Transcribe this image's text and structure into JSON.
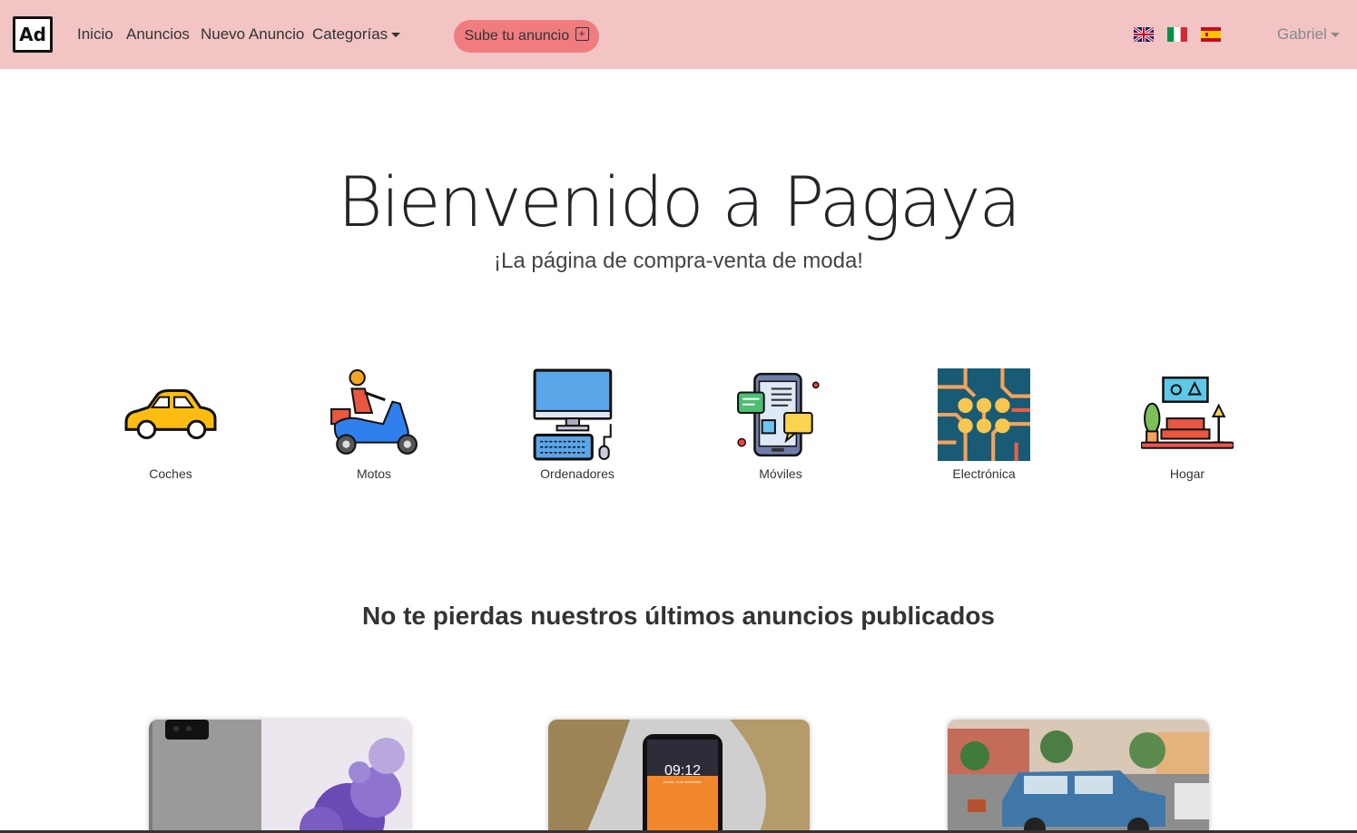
{
  "navbar": {
    "logo_text": "Ad",
    "links": [
      "Inicio",
      "Anuncios",
      "Nuevo Anuncio"
    ],
    "categories_label": "Categorías",
    "upload_button": "Sube tu anuncio",
    "upload_icon": "+",
    "user_name": "Gabriel",
    "flags": [
      "uk-flag-icon",
      "italy-flag-icon",
      "spain-flag-icon"
    ]
  },
  "hero": {
    "title": "Bienvenido a Pagaya",
    "subtitle": "¡La página de compra-venta de moda!"
  },
  "categories": [
    {
      "label": "Coches",
      "icon": "car-icon"
    },
    {
      "label": "Motos",
      "icon": "scooter-icon"
    },
    {
      "label": "Ordenadores",
      "icon": "computer-icon"
    },
    {
      "label": "Móviles",
      "icon": "smartphone-icon"
    },
    {
      "label": "Electrónica",
      "icon": "circuit-icon"
    },
    {
      "label": "Hogar",
      "icon": "home-furniture-icon"
    }
  ],
  "latest": {
    "title": "No te pierdas nuestros últimos anuncios publicados",
    "phone_time": "09:12",
    "phone_date": "jueves, 4 de noviembre"
  },
  "colors": {
    "navbar_bg": "#f2c4c4",
    "upload_button_bg": "#f07c80"
  }
}
